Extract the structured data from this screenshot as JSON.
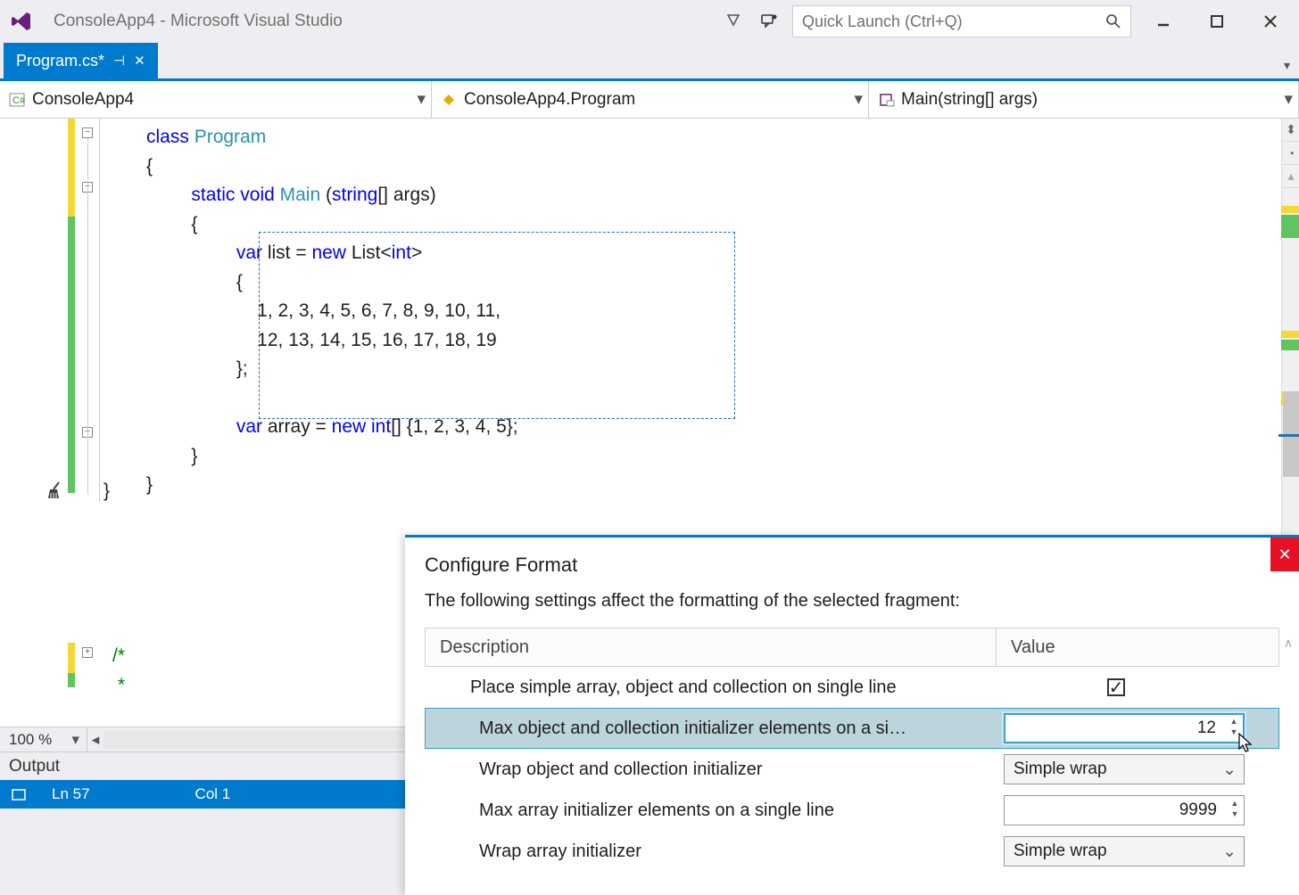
{
  "window": {
    "title": "ConsoleApp4 - Microsoft Visual Studio",
    "quick_launch_placeholder": "Quick Launch (Ctrl+Q)"
  },
  "tab": {
    "name": "Program.cs*"
  },
  "navbar": {
    "project": "ConsoleApp4",
    "class": "ConsoleApp4.Program",
    "method": "Main(string[] args)"
  },
  "code": {
    "l1_kw": "class",
    "l1_typ": " Program",
    "l2": "{",
    "l3_kw1": "static",
    "l3_kw2": " void",
    "l3_typ": " Main ",
    "l3_rest1": "(",
    "l3_kw3": "string",
    "l3_rest2": "[] args)",
    "l4": "{",
    "l5_kw": "var",
    "l5_txt1": " list = ",
    "l5_kw2": "new",
    "l5_txt2": " List<",
    "l5_kw3": "int",
    "l5_txt3": ">",
    "l6": "{",
    "l7": "    1, 2, 3, 4, 5, 6, 7, 8, 9, 10, 11,",
    "l8": "    12, 13, 14, 15, 16, 17, 18, 19",
    "l9": "};",
    "l10": "",
    "l11_kw": "var",
    "l11_txt1": " array = ",
    "l11_kw2": "new",
    "l11_txt2": " ",
    "l11_kw3": "int",
    "l11_txt3": "[] {1, 2, 3, 4, 5};",
    "l12": "}",
    "l13": "}",
    "l14": "}",
    "comment1": "/*",
    "comment2": " *"
  },
  "zoom": "100 %",
  "output_label": "Output",
  "status": {
    "line": "Ln 57",
    "col": "Col 1"
  },
  "popup": {
    "title": "Configure Format",
    "desc": "The following settings affect the formatting of the selected fragment:",
    "head1": "Description",
    "head2": "Value",
    "rows": [
      {
        "label": "Place simple array, object and collection on single line",
        "checked": true
      },
      {
        "label": "Max object and collection initializer elements on a si…",
        "value": "12"
      },
      {
        "label": "Wrap object and collection initializer",
        "value": "Simple wrap"
      },
      {
        "label": "Max array initializer elements on a single line",
        "value": "9999"
      },
      {
        "label": "Wrap array initializer",
        "value": "Simple wrap"
      }
    ]
  }
}
